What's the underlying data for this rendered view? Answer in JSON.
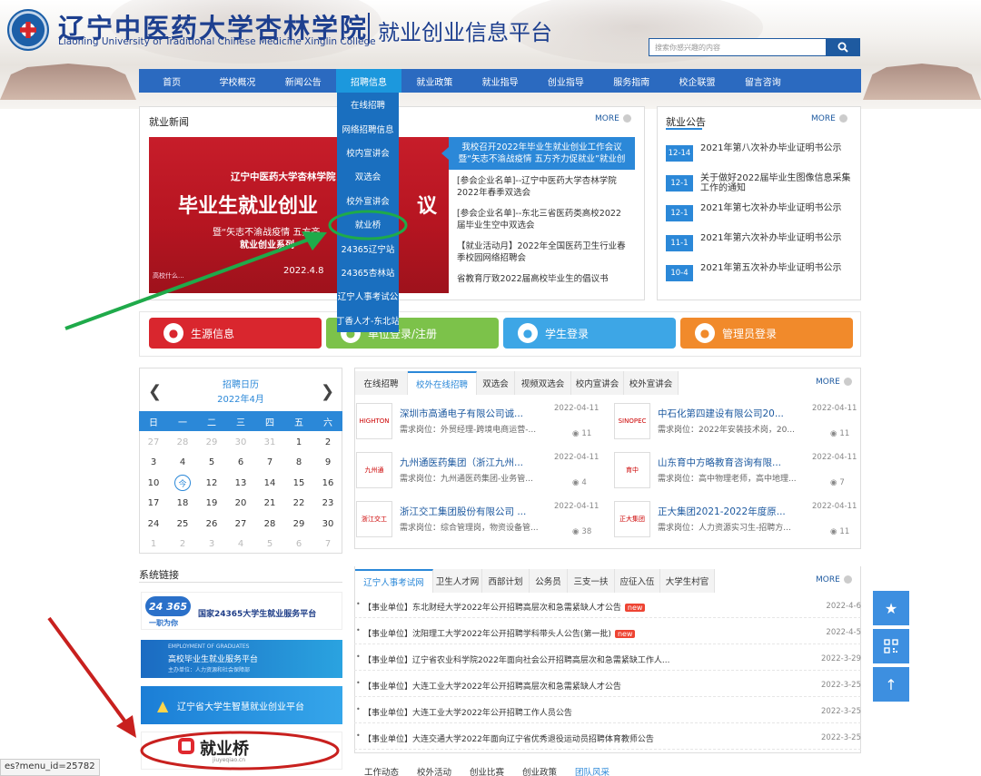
{
  "header": {
    "school_name_cn": "辽宁中医药大学杏林学院",
    "school_name_en": "Liaoning University of Traditional Chinese Medicine Xinglin College",
    "platform_title": "就业创业信息平台",
    "search_placeholder": "搜索你感兴趣的内容"
  },
  "nav": {
    "items": [
      "首页",
      "学校概况",
      "新闻公告",
      "招聘信息",
      "就业政策",
      "就业指导",
      "创业指导",
      "服务指南",
      "校企联盟",
      "留言咨询"
    ],
    "active_index": 3
  },
  "dropdown": {
    "items": [
      "在线招聘",
      "网络招聘信息",
      "校内宣讲会",
      "双选会",
      "校外宣讲会",
      "就业桥",
      "24365辽宁站",
      "24365杏林站",
      "辽宁人事考试公",
      "丁香人才-东北站"
    ]
  },
  "news": {
    "title": "就业新闻",
    "more": "MORE",
    "banner": {
      "org": "辽宁中医药大学杏林学院",
      "headline": "毕业生就业创业",
      "headline_tail": "议",
      "slogan": "暨“矢志不渝战疫情  五方齐",
      "series": "就业创业系列",
      "series_tail": "启动",
      "date": "2022.4.8",
      "caption": "高校什么..."
    },
    "highlight": "我校召开2022年毕业生就业创业工作会议 暨“矢志不渝战疫情 五方齐力促就业”就业创",
    "items": [
      "[参会企业名单]--辽宁中医药大学杏林学院2022年春季双选会",
      "[参会企业名单]--东北三省医药类高校2022届毕业生空中双选会",
      "【就业活动月】2022年全国医药卫生行业春季校园网络招聘会",
      "省教育厅致2022届高校毕业生的倡议书"
    ]
  },
  "announcements": {
    "title": "就业公告",
    "more": "MORE",
    "items": [
      {
        "date": "12-14",
        "text": "2021年第八次补办毕业证明书公示"
      },
      {
        "date": "12-1",
        "text": "关于做好2022届毕业生图像信息采集工作的通知"
      },
      {
        "date": "12-1",
        "text": "2021年第七次补办毕业证明书公示"
      },
      {
        "date": "11-1",
        "text": "2021年第六次补办毕业证明书公示"
      },
      {
        "date": "10-4",
        "text": "2021年第五次补办毕业证明书公示"
      }
    ]
  },
  "login": {
    "items": [
      {
        "label": "生源信息",
        "icon": "person-icon",
        "color": "#d9262e"
      },
      {
        "label": "单位登录/注册",
        "icon": "building-icon",
        "color": "#7cc24a"
      },
      {
        "label": "学生登录",
        "icon": "student-icon",
        "color": "#3da6e6"
      },
      {
        "label": "管理员登录",
        "icon": "admin-icon",
        "color": "#f18a2b"
      }
    ]
  },
  "calendar": {
    "title": "招聘日历",
    "month": "2022年4月",
    "weekdays": [
      "日",
      "一",
      "二",
      "三",
      "四",
      "五",
      "六"
    ],
    "weeks": [
      [
        "27",
        "28",
        "29",
        "30",
        "31",
        "1",
        "2"
      ],
      [
        "3",
        "4",
        "5",
        "6",
        "7",
        "8",
        "9"
      ],
      [
        "10",
        "今",
        "12",
        "13",
        "14",
        "15",
        "16"
      ],
      [
        "17",
        "18",
        "19",
        "20",
        "21",
        "22",
        "23"
      ],
      [
        "24",
        "25",
        "26",
        "27",
        "28",
        "29",
        "30"
      ],
      [
        "1",
        "2",
        "3",
        "4",
        "5",
        "6",
        "7"
      ]
    ]
  },
  "jobs": {
    "tabs": [
      "在线招聘",
      "校外在线招聘",
      "双选会",
      "视频双选会",
      "校内宣讲会",
      "校外宣讲会"
    ],
    "active_tab": 1,
    "more": "MORE",
    "items": [
      {
        "title": "深圳市高通电子有限公司诚...",
        "req": "需求岗位：外贸经理-跨境电商运营-...",
        "date": "2022-04-11",
        "views": "11",
        "logo": "HIGHTON"
      },
      {
        "title": "中石化第四建设有限公司20...",
        "req": "需求岗位：2022年安装技术岗，20...",
        "date": "2022-04-11",
        "views": "11",
        "logo": "SINOPEC"
      },
      {
        "title": "九州通医药集团（浙江九州...",
        "req": "需求岗位：九州通医药集团-业务管...",
        "date": "2022-04-11",
        "views": "4",
        "logo": "九州通"
      },
      {
        "title": "山东育中方略教育咨询有限...",
        "req": "需求岗位：高中物理老师，高中地理...",
        "date": "2022-04-11",
        "views": "7",
        "logo": "育中"
      },
      {
        "title": "浙江交工集团股份有限公司 ...",
        "req": "需求岗位：综合管理岗，物资设备管...",
        "date": "2022-04-11",
        "views": "38",
        "logo": "浙江交工"
      },
      {
        "title": "正大集团2021-2022年度原...",
        "req": "需求岗位：人力资源实习生-招聘方...",
        "date": "2022-04-11",
        "views": "11",
        "logo": "正大集团"
      }
    ]
  },
  "links": {
    "title": "系统链接",
    "items": [
      "国家24365大学生就业服务平台",
      "高校毕业生就业服务平台",
      "辽宁省大学生智慧就业创业平台",
      "就业桥"
    ],
    "sub": {
      "n24365": "24 365",
      "slogan": "一职为你",
      "emp": "EMPLOYMENT OF GRADUATES",
      "emp_sub": "主办单位：人力资源和社会保障部",
      "jyq_pinyin": "jiuyeqiao.cn"
    }
  },
  "notices": {
    "tabs": [
      "辽宁人事考试网",
      "卫生人才网",
      "西部计划",
      "公务员",
      "三支一扶",
      "应征入伍",
      "大学生村官"
    ],
    "active_tab": 0,
    "more": "MORE",
    "new_label": "new",
    "items": [
      {
        "text": "【事业单位】东北财经大学2022年公开招聘高层次和急需紧缺人才公告",
        "date": "2022-4-6",
        "new": true
      },
      {
        "text": "【事业单位】沈阳理工大学2022年公开招聘学科带头人公告(第一批)",
        "date": "2022-4-5",
        "new": true
      },
      {
        "text": "【事业单位】辽宁省农业科学院2022年面向社会公开招聘高层次和急需紧缺工作人...",
        "date": "2022-3-29",
        "new": false
      },
      {
        "text": "【事业单位】大连工业大学2022年公开招聘高层次和急需紧缺人才公告",
        "date": "2022-3-25",
        "new": false
      },
      {
        "text": "【事业单位】大连工业大学2022年公开招聘工作人员公告",
        "date": "2022-3-25",
        "new": false
      },
      {
        "text": "【事业单位】大连交通大学2022年面向辽宁省优秀退役运动员招聘体育教师公告",
        "date": "2022-3-25",
        "new": false
      }
    ]
  },
  "bottom_tabs": [
    "工作动态",
    "校外活动",
    "创业比赛",
    "创业政策",
    "团队风采"
  ],
  "status_bar": "es?menu_id=25782",
  "colors": {
    "nav": "#2b6ac0",
    "accent": "#2b88d8",
    "annotation_green": "#1faa4a",
    "annotation_red": "#d21f1f"
  }
}
